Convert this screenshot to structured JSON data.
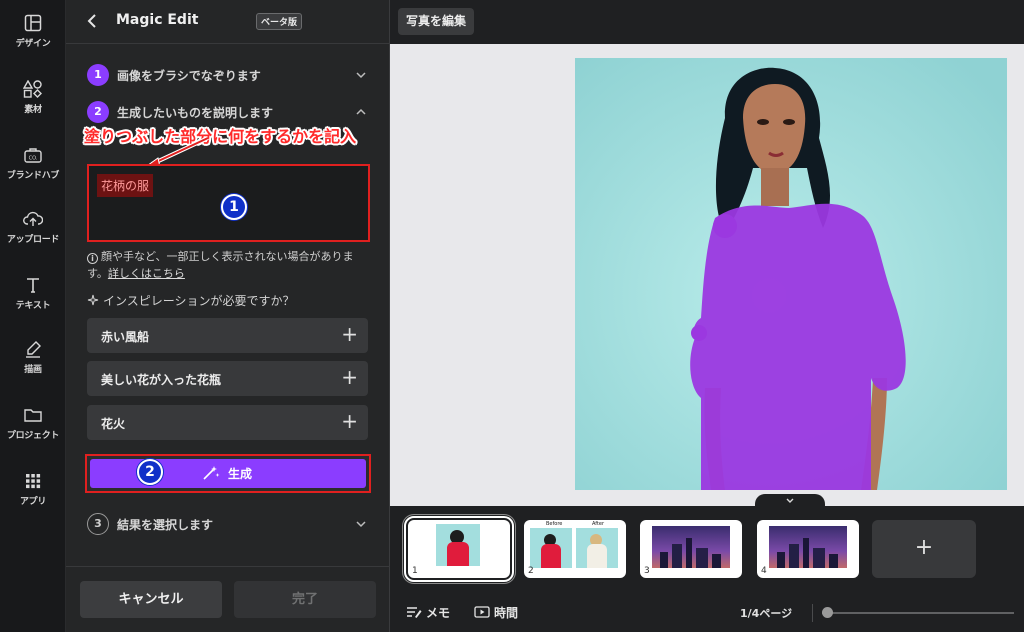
{
  "rail": {
    "items": [
      {
        "label": "デザイン",
        "icon": "layout-icon"
      },
      {
        "label": "素材",
        "icon": "elements-icon"
      },
      {
        "label": "ブランドハブ",
        "icon": "brand-icon"
      },
      {
        "label": "アップロード",
        "icon": "upload-icon"
      },
      {
        "label": "テキスト",
        "icon": "text-icon"
      },
      {
        "label": "描画",
        "icon": "draw-icon"
      },
      {
        "label": "プロジェクト",
        "icon": "folder-icon"
      },
      {
        "label": "アプリ",
        "icon": "apps-icon"
      }
    ]
  },
  "panel": {
    "title": "Magic Edit",
    "beta": "ベータ版",
    "steps": [
      {
        "num": "1",
        "label": "画像をブラシでなぞります"
      },
      {
        "num": "2",
        "label": "生成したいものを説明します"
      },
      {
        "num": "3",
        "label": "結果を選択します"
      }
    ],
    "annotation": "塗りつぶした部分に何をするかを記入",
    "prompt_value": "花柄の服",
    "badge1": "1",
    "badge2": "2",
    "notice_text": "顔や手など、一部正しく表示されない場合がありま",
    "notice_text2": "す。",
    "notice_link": "詳しくはこちら",
    "inspire": "インスピレーションが必要ですか？",
    "suggestions": [
      "赤い風船",
      "美しい花が入った花瓶",
      "花火"
    ],
    "generate": "生成",
    "cancel": "キャンセル",
    "done": "完了"
  },
  "editor": {
    "edit_photo": "写真を編集",
    "thumbs": [
      {
        "num": "1"
      },
      {
        "num": "2",
        "before": "Before",
        "after": "After"
      },
      {
        "num": "3"
      },
      {
        "num": "4"
      }
    ],
    "add_page": "+",
    "memo": "メモ",
    "time": "時間",
    "page_count": "1/4ページ"
  },
  "colors": {
    "accent": "#8b3dff",
    "annotation_red": "#e0201f",
    "badge_blue": "#1030c8",
    "mask_purple": "#9b38e0",
    "photo_bg": "#a3dede"
  }
}
